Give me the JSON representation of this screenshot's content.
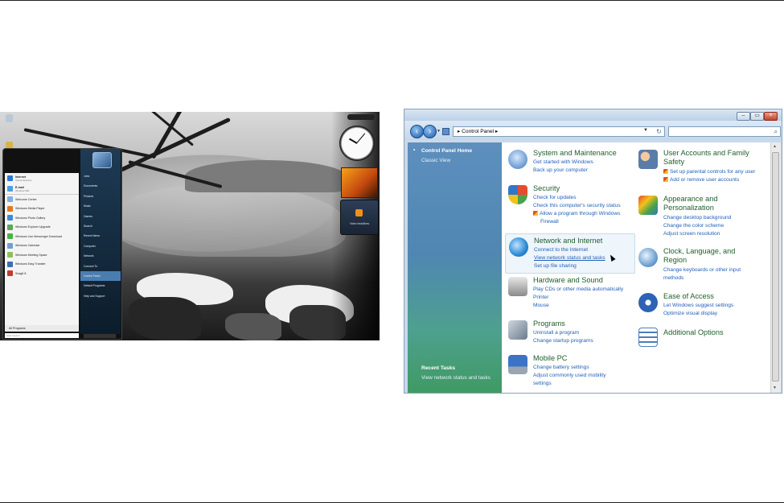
{
  "desktop": {
    "start_menu": {
      "pinned": [
        {
          "label": "Internet",
          "sub": "Internet Explorer"
        },
        {
          "label": "E-mail",
          "sub": "Windows Mail"
        }
      ],
      "programs": [
        "Welcome Center",
        "Windows Media Player",
        "Windows Photo Gallery",
        "Windows Explorer Upgrade",
        "Windows Live Messenger Download",
        "Windows Calendar",
        "Windows Meeting Space",
        "Windows Easy Transfer",
        "SnagIt 8"
      ],
      "all_programs": "All Programs",
      "search_placeholder": "Start Search",
      "right_items": [
        "John",
        "Documents",
        "Pictures",
        "Music",
        "Games",
        "Search",
        "Recent Items",
        "Computer",
        "Network",
        "Connect To",
        "Control Panel",
        "Default Programs",
        "Help and Support"
      ],
      "highlighted_item": "Control Panel"
    },
    "gadgets": {
      "feed_label": "Video headlines"
    }
  },
  "control_panel": {
    "address": {
      "crumb": "Control Panel",
      "search_placeholder": ""
    },
    "sidebar": {
      "home": "Control Panel Home",
      "classic": "Classic View",
      "recent_tasks_title": "Recent Tasks",
      "recent_tasks": [
        "View network status and tasks"
      ]
    },
    "categories_left": [
      {
        "title": "System and Maintenance",
        "links": [
          "Get started with Windows",
          "Back up your computer"
        ]
      },
      {
        "title": "Security",
        "links": [
          "Check for updates",
          "Check this computer's security status",
          "Allow a program through Windows",
          "Firewall"
        ]
      },
      {
        "title": "Network and Internet",
        "links": [
          "Connect to the Internet",
          "View network status and tasks",
          "Set up file sharing"
        ]
      },
      {
        "title": "Hardware and Sound",
        "links": [
          "Play CDs or other media automatically",
          "Printer",
          "Mouse"
        ]
      },
      {
        "title": "Programs",
        "links": [
          "Uninstall a program",
          "Change startup programs"
        ]
      },
      {
        "title": "Mobile PC",
        "links": [
          "Change battery settings",
          "Adjust commonly used mobility",
          "settings"
        ]
      }
    ],
    "categories_right": [
      {
        "title_lines": [
          "User Accounts and Family",
          "Safety"
        ],
        "links": [
          "Set up parental controls for any user",
          "Add or remove user accounts"
        ]
      },
      {
        "title_lines": [
          "Appearance and",
          "Personalization"
        ],
        "links": [
          "Change desktop background",
          "Change the color scheme",
          "Adjust screen resolution"
        ]
      },
      {
        "title_lines": [
          "Clock, Language, and",
          "Region"
        ],
        "links": [
          "Change keyboards or other input",
          "methods"
        ]
      },
      {
        "title_lines": [
          "Ease of Access"
        ],
        "links": [
          "Let Windows suggest settings",
          "Optimize visual display"
        ]
      },
      {
        "title_lines": [
          "Additional Options"
        ],
        "links": []
      }
    ]
  }
}
